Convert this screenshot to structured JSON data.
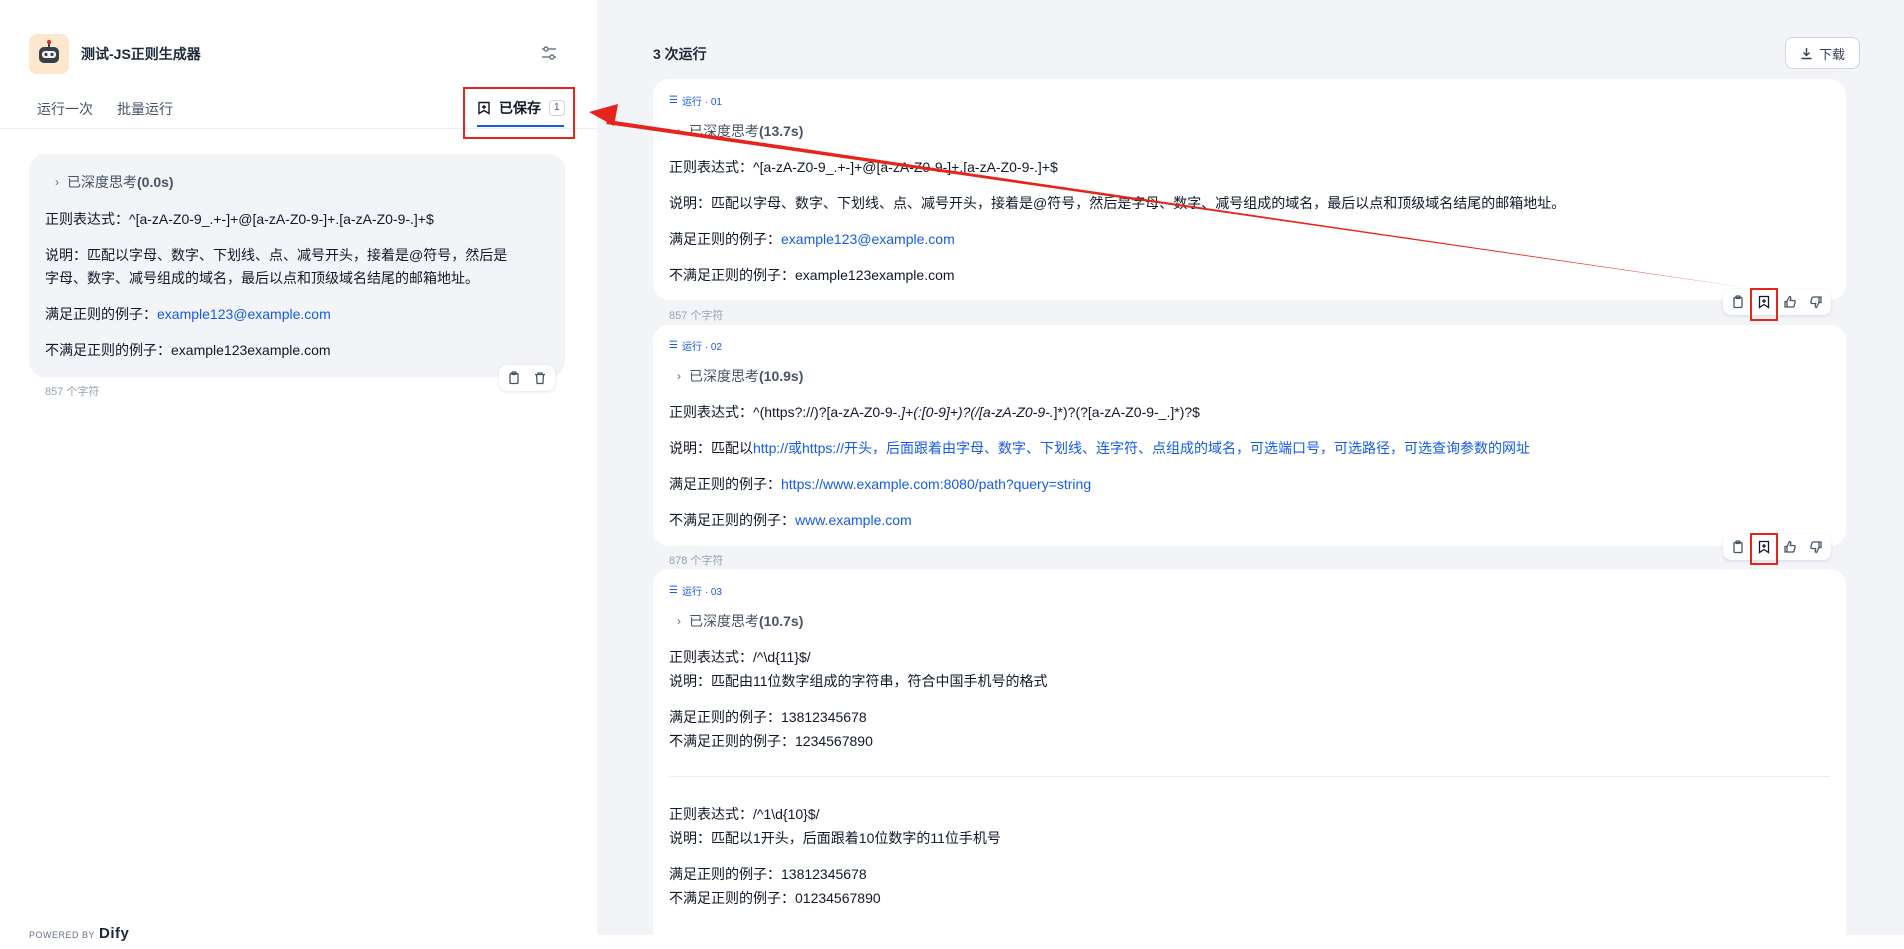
{
  "app": {
    "title": "测试-JS正则生成器"
  },
  "left_tabs": {
    "run_once": "运行一次",
    "batch_run": "批量运行",
    "saved": "已保存",
    "saved_count": "1"
  },
  "saved_item": {
    "think": "已深度思考",
    "think_time": "(0.0s)",
    "regex": "正则表达式：^[a-zA-Z0-9_.+-]+@[a-zA-Z0-9-]+.[a-zA-Z0-9-.]+$",
    "desc_line1": "说明：匹配以字母、数字、下划线、点、减号开头，接着是@符号，然后是",
    "desc_line2": "字母、数字、减号组成的域名，最后以点和顶级域名结尾的邮箱地址。",
    "match_label": "满足正则的例子：",
    "match_value": "example123@example.com",
    "nomatch": "不满足正则的例子：example123example.com",
    "chars": "857 个字符"
  },
  "powered_by": {
    "prefix": "POWERED BY",
    "brand": "Dify"
  },
  "right_header": {
    "runs": "3 次运行",
    "download": "下载"
  },
  "runs": [
    {
      "label": "运行 · 01",
      "think": "已深度思考",
      "think_time": "(13.7s)",
      "regex": "正则表达式：^[a-zA-Z0-9_.+-]+@[a-zA-Z0-9-]+.[a-zA-Z0-9-.]+$",
      "desc": "说明：匹配以字母、数字、下划线、点、减号开头，接着是@符号，然后是字母、数字、减号组成的域名，最后以点和顶级域名结尾的邮箱地址。",
      "match_label": "满足正则的例子：",
      "match_value": "example123@example.com",
      "nomatch": "不满足正则的例子：example123example.com",
      "chars": "857 个字符"
    },
    {
      "label": "运行 · 02",
      "think": "已深度思考",
      "think_time": "(10.9s)",
      "regex_prefix": "正则表达式：^(https?://)?[a-zA-Z0-9-.",
      "regex_italic": "]+(:[0-9]+)?(/[a-zA-Z0-9-.",
      "regex_suffix": "]*)?(?[a-zA-Z0-9-_.]*)?$",
      "desc_prefix": "说明：匹配以",
      "desc_link": "http://或https://开头，后面跟着由字母、数字、下划线、连字符、点组成的域名，可选端口号，可选路径，可选查询参数的网址",
      "match_label": "满足正则的例子：",
      "match_value": "https://www.example.com:8080/path?query=string",
      "nomatch_label": "不满足正则的例子：",
      "nomatch_value": "www.example.com",
      "chars": "878 个字符"
    },
    {
      "label": "运行 · 03",
      "think": "已深度思考",
      "think_time": "(10.7s)",
      "block1": {
        "regex": "正则表达式：/^\\d{11}$/",
        "desc": "说明：匹配由11位数字组成的字符串，符合中国手机号的格式",
        "match": "满足正则的例子：13812345678",
        "nomatch": "不满足正则的例子：1234567890"
      },
      "block2": {
        "regex": "正则表达式：/^1\\d{10}$/",
        "desc": "说明：匹配以1开头，后面跟着10位数字的11位手机号",
        "match": "满足正则的例子：13812345678",
        "nomatch": "不满足正则的例子：01234567890"
      }
    }
  ],
  "colors": {
    "accent": "#155aef",
    "highlight": "#e5251b",
    "panel": "#f2f4f7"
  }
}
